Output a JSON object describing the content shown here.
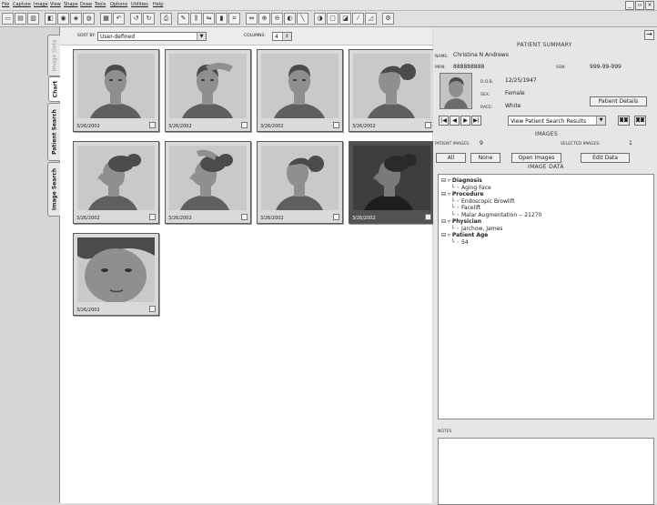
{
  "menu": [
    "File",
    "Capture",
    "Image",
    "View",
    "Shape",
    "Draw",
    "Tools",
    "Options",
    "Utilities",
    "Help"
  ],
  "window_controls": [
    "_",
    "▫",
    "×"
  ],
  "toolbar_icons": [
    "new-icon",
    "open-icon",
    "print-icon",
    "capture-icon",
    "camera-icon",
    "scanner-icon",
    "video-icon",
    "grid-icon",
    "undo-icon",
    "rotate-left-icon",
    "rotate-right-icon",
    "printer-icon",
    "pencil-icon",
    "split-icon",
    "compare-icon",
    "measure-icon",
    "crop-icon",
    "flip-icon",
    "zoom-in-icon",
    "zoom-out-icon",
    "paint-icon",
    "brightness-icon",
    "contrast-icon",
    "lighten-icon",
    "filter-icon",
    "eyedropper-icon",
    "settings-icon"
  ],
  "tabs": [
    {
      "label": "Image Data",
      "active": false
    },
    {
      "label": "Chart",
      "active": true
    },
    {
      "label": "Patient Search",
      "active": true
    },
    {
      "label": "Image Search",
      "active": true
    }
  ],
  "sortbar": {
    "sort_label": "SORT BY:",
    "sort_value": "User-defined",
    "columns_label": "COLUMNS:",
    "columns_value": "4"
  },
  "thumbnails": [
    {
      "date": "3/26/2002",
      "pose": "front",
      "selected": false
    },
    {
      "date": "3/26/2002",
      "pose": "front-hand",
      "selected": false
    },
    {
      "date": "3/26/2002",
      "pose": "front",
      "selected": false
    },
    {
      "date": "3/26/2002",
      "pose": "oblique",
      "selected": false
    },
    {
      "date": "3/26/2002",
      "pose": "profile",
      "selected": false
    },
    {
      "date": "3/26/2002",
      "pose": "profile-hand",
      "selected": false
    },
    {
      "date": "3/26/2002",
      "pose": "oblique-back",
      "selected": false
    },
    {
      "date": "3/26/2002",
      "pose": "profile-dark",
      "selected": true
    },
    {
      "date": "3/26/2002",
      "pose": "closeup",
      "selected": false
    }
  ],
  "patient": {
    "heading": "PATIENT SUMMARY",
    "name_label": "NAME:",
    "name": "Christina N Andrews",
    "mrn_label": "MRN:",
    "mrn": "888888888",
    "ssn_label": "SSN:",
    "ssn": "999-99-999",
    "dob_label": "D.O.B.",
    "dob": "12/25/1947",
    "sex_label": "SEX:",
    "sex": "Female",
    "race_label": "RACE:",
    "race": "White",
    "details_button": "Patient Details"
  },
  "nav": {
    "buttons": [
      "|◀",
      "◀",
      "▶",
      "▶|"
    ],
    "view_select": "View Patient Search Results"
  },
  "images": {
    "heading": "IMAGES",
    "patient_images_label": "PATIENT IMAGES:",
    "patient_images_count": "9",
    "selected_images_label": "SELECTED IMAGES:",
    "selected_images_count": "1",
    "all_button": "All",
    "none_button": "None",
    "open_button": "Open Images",
    "edit_button": "Edit Data"
  },
  "image_data": {
    "heading": "IMAGE DATA",
    "tree": [
      {
        "label": "Diagnosis",
        "level": 0,
        "bold": true
      },
      {
        "label": "Aging Face",
        "level": 1,
        "bold": false
      },
      {
        "label": "Procedure",
        "level": 0,
        "bold": true
      },
      {
        "label": "Endoscopic Browlift",
        "level": 1,
        "bold": false
      },
      {
        "label": "Facelift",
        "level": 1,
        "bold": false
      },
      {
        "label": "Malar Augmentation -- 21270",
        "level": 1,
        "bold": false
      },
      {
        "label": "Physician",
        "level": 0,
        "bold": true
      },
      {
        "label": "Jarchow, James",
        "level": 1,
        "bold": false
      },
      {
        "label": "Patient Age",
        "level": 0,
        "bold": true
      },
      {
        "label": "54",
        "level": 1,
        "bold": false
      }
    ]
  },
  "notes": {
    "label": "NOTES"
  },
  "colors": {
    "selected_thumb": "#525252",
    "panel_bg": "#e6e6e6",
    "sidebar_bg": "#d6d6d6"
  }
}
